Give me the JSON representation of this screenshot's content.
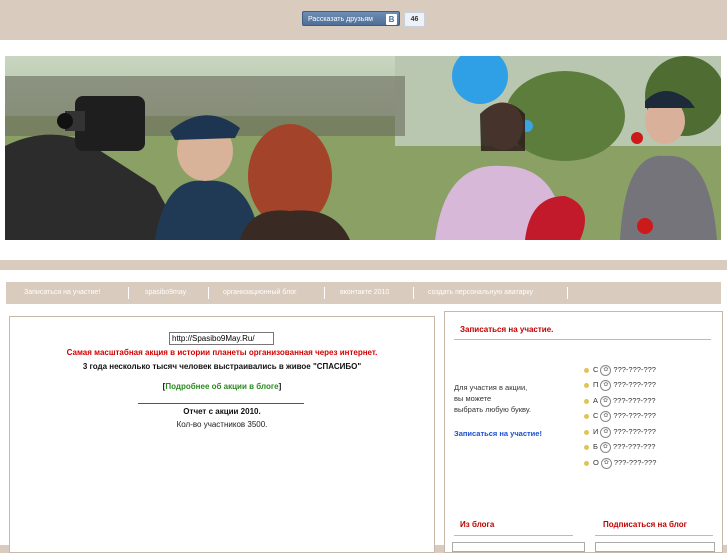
{
  "share": {
    "label": "Рассказать друзьям",
    "vk_icon": "B",
    "count": "46"
  },
  "nav": {
    "items": [
      "Записаться на участие!",
      "spasibo9may",
      "организационный блог",
      "вконтакте 2010",
      "создать персональную аватарку"
    ]
  },
  "main": {
    "url_value": "http://Spasibo9May.Ru/",
    "headline": "Самая масштабная акция в истории планеты организованная через интернет.",
    "subline": "3 года несколько тысяч человек выстраивались в живое \"СПАСИБО\"",
    "more_link_open": "[",
    "more_link": "Подробнее об акции в блоге",
    "more_link_close": "]",
    "report_title": "Отчет с акции 2010.",
    "report_count": "Кол-во участников 3500."
  },
  "sidebar": {
    "title": "Записаться на участие.",
    "desc_1": "Для участия в акции,",
    "desc_2": "вы можете",
    "desc_3": "выбрать любую букву.",
    "signup_link": "Записаться на участие!",
    "letters": [
      {
        "letter": "С",
        "value": "???-???-???"
      },
      {
        "letter": "П",
        "value": "???-???-???"
      },
      {
        "letter": "А",
        "value": "???-???-???"
      },
      {
        "letter": "С",
        "value": "???-???-???"
      },
      {
        "letter": "И",
        "value": "???-???-???"
      },
      {
        "letter": "Б",
        "value": "???-???-???"
      },
      {
        "letter": "О",
        "value": "???-???-???"
      }
    ],
    "from_blog": "Из блога",
    "subscribe": "Подписаться на блог"
  },
  "colors": {
    "beige": "#d9cbbd",
    "red": "#d40000",
    "green": "#2a8a1f",
    "link_blue": "#1a4fcf"
  },
  "icons": {
    "vk": "vk-icon",
    "flower": "flower-icon",
    "bullet": "bullet-icon"
  }
}
